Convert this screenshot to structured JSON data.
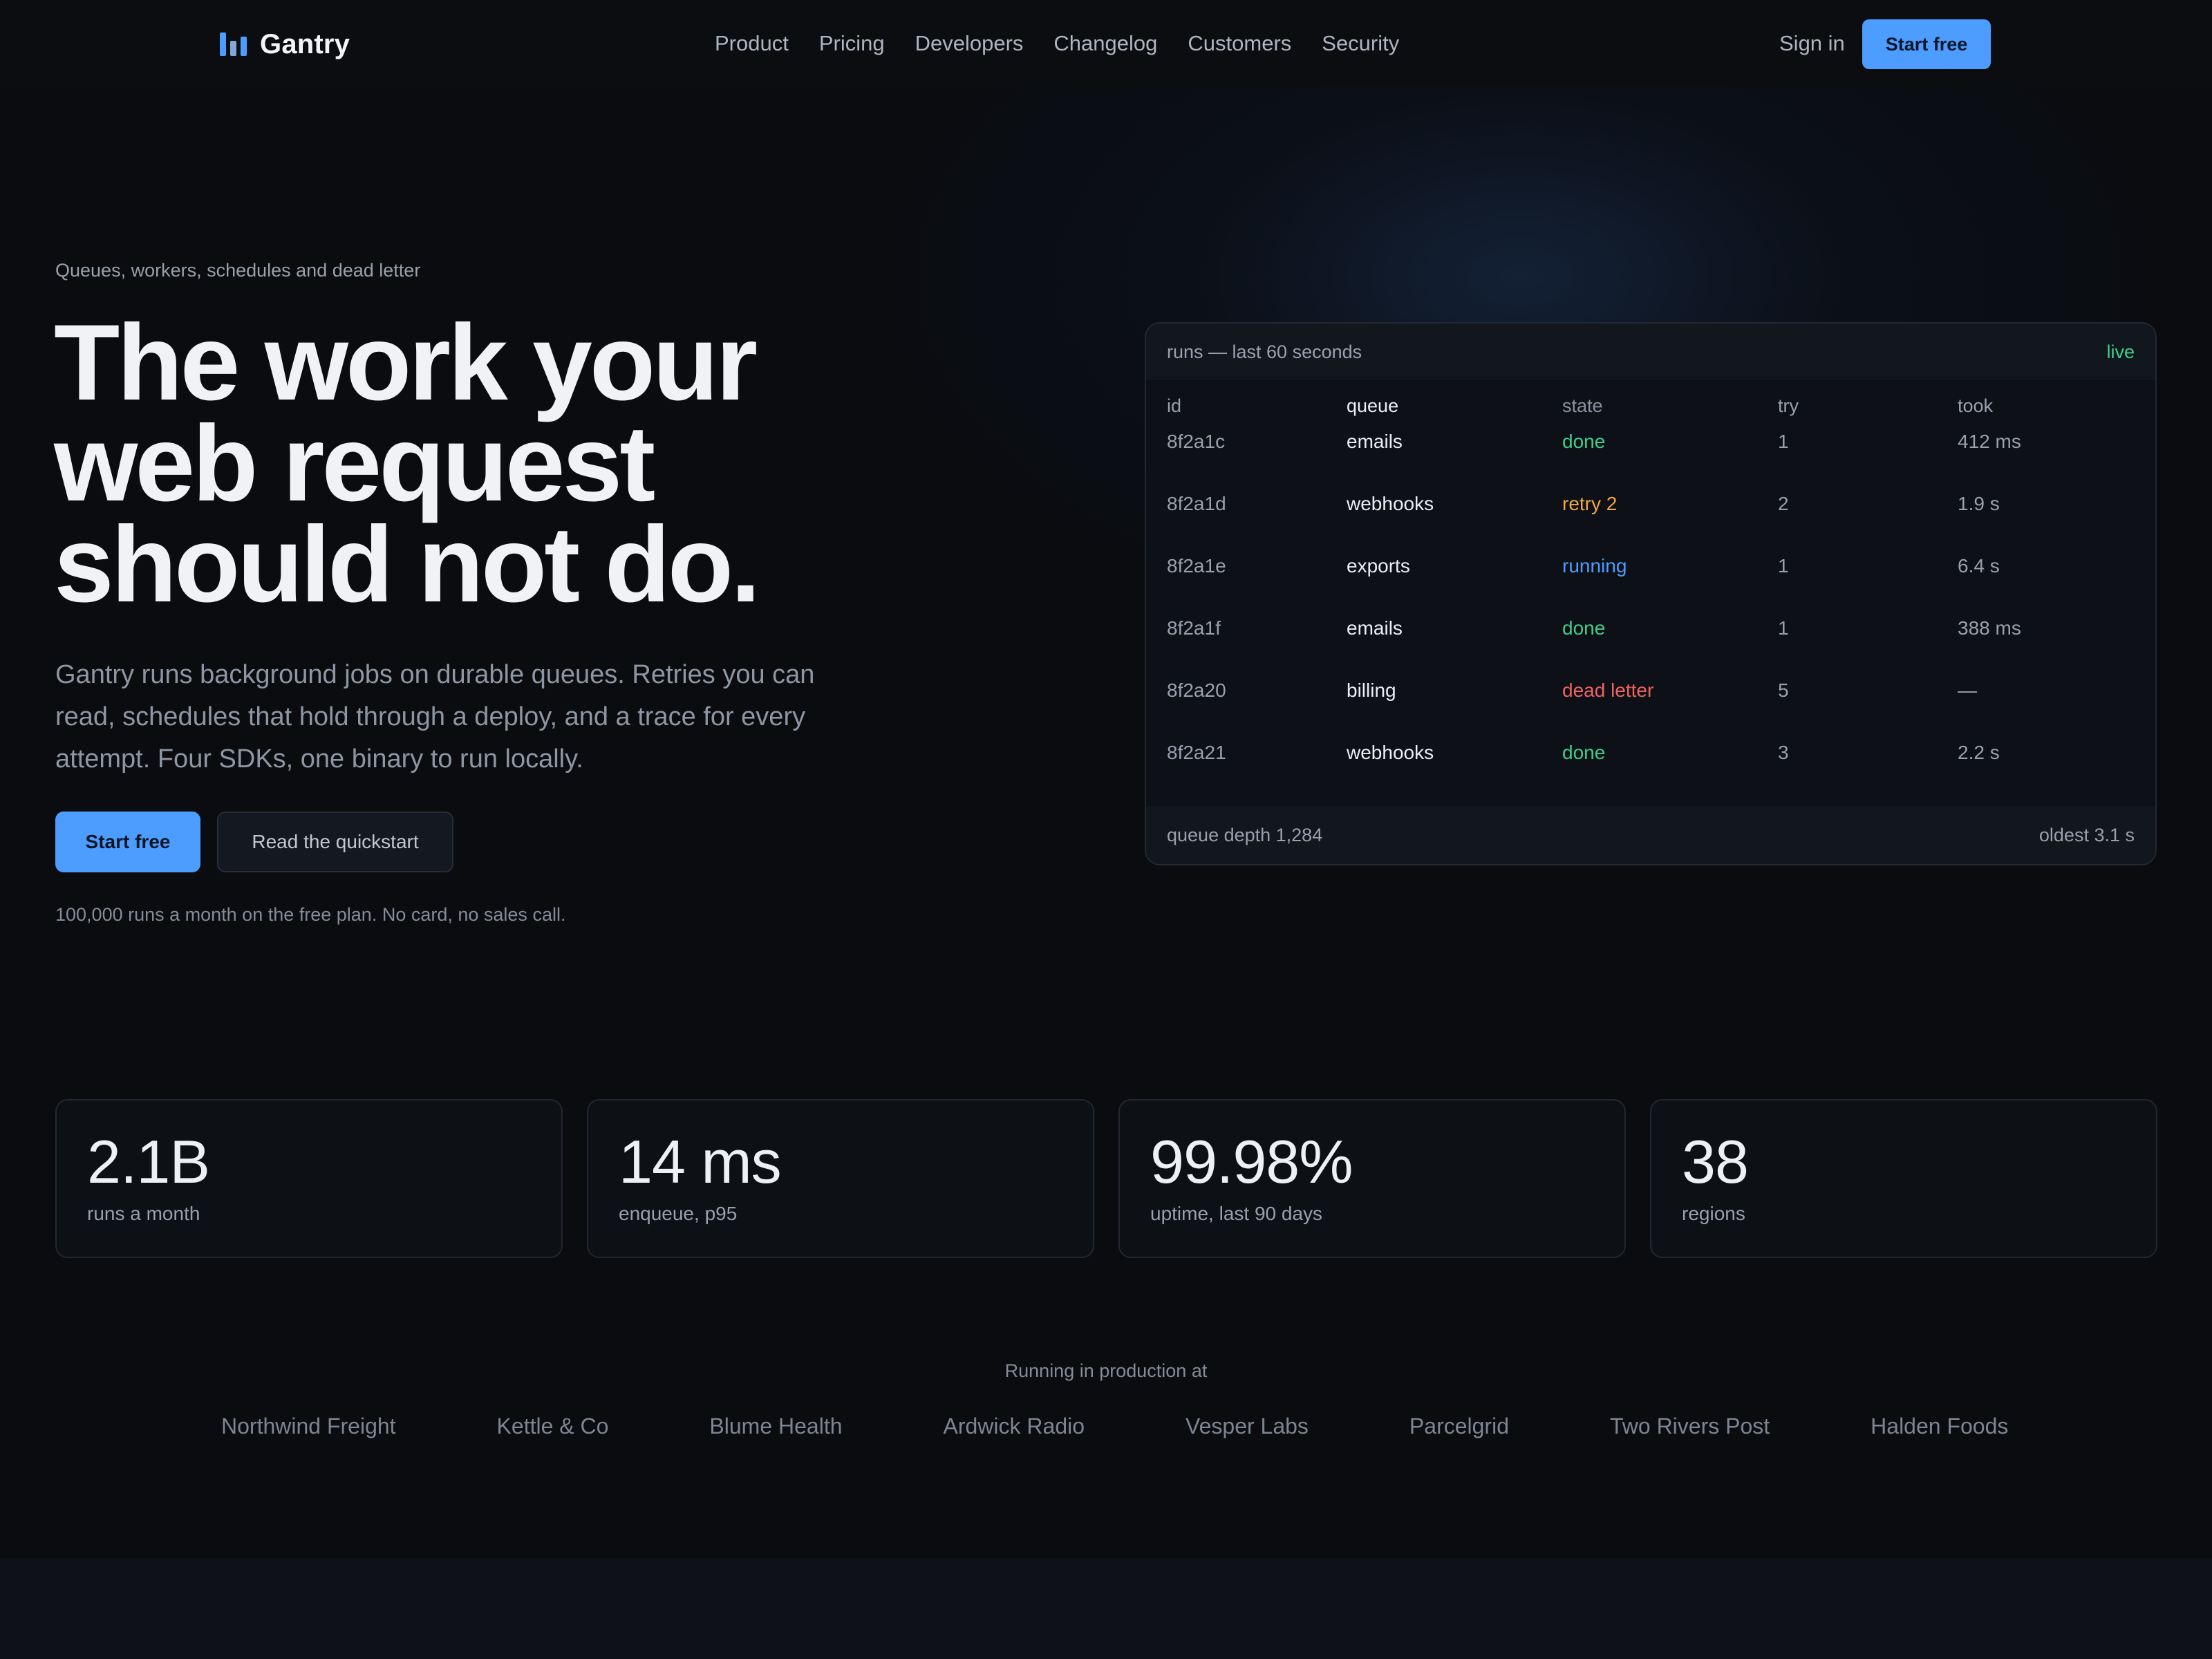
{
  "nav": {
    "brand": "Gantry",
    "links": [
      "Product",
      "Pricing",
      "Developers",
      "Changelog",
      "Customers",
      "Security"
    ],
    "sign_in": "Sign in",
    "cta": "Start free"
  },
  "hero": {
    "eyebrow": "Queues, workers, schedules and dead letter",
    "headline": [
      "The work your",
      "web request",
      "should not do."
    ],
    "lede": "Gantry runs background jobs on durable queues. Retries you can read, schedules that hold through a deploy, and a trace for every attempt. Four SDKs, one binary to run locally.",
    "primary_cta": "Start free",
    "secondary_cta": "Read the quickstart",
    "fineprint": "100,000 runs a month on the free plan. No card, no sales call."
  },
  "runs_panel": {
    "title": "runs — last 60 seconds",
    "status": "live",
    "columns": [
      "id",
      "queue",
      "state",
      "try",
      "took"
    ],
    "rows": [
      {
        "id": "8f2a1c",
        "queue": "emails",
        "state": "done",
        "try": "1",
        "took": "412 ms"
      },
      {
        "id": "8f2a1d",
        "queue": "webhooks",
        "state": "retry 2",
        "try": "2",
        "took": "1.9 s"
      },
      {
        "id": "8f2a1e",
        "queue": "exports",
        "state": "running",
        "try": "1",
        "took": "6.4 s"
      },
      {
        "id": "8f2a1f",
        "queue": "emails",
        "state": "done",
        "try": "1",
        "took": "388 ms"
      },
      {
        "id": "8f2a20",
        "queue": "billing",
        "state": "dead letter",
        "try": "5",
        "took": "—"
      },
      {
        "id": "8f2a21",
        "queue": "webhooks",
        "state": "done",
        "try": "3",
        "took": "2.2 s"
      }
    ],
    "footer_left": "queue depth 1,284",
    "footer_right": "oldest 3.1 s",
    "state_colors": {
      "done": "#3ecf8e",
      "retry": "#f0a842",
      "running": "#4c9dff",
      "dead_letter": "#f06262"
    }
  },
  "stats": [
    {
      "value": "2.1B",
      "label": "runs a month"
    },
    {
      "value": "14 ms",
      "label": "enqueue, p95"
    },
    {
      "value": "99.98%",
      "label": "uptime, last 90 days"
    },
    {
      "value": "38",
      "label": "regions"
    }
  ],
  "customers": {
    "title": "Running in production at",
    "logos": [
      "Northwind Freight",
      "Kettle & Co",
      "Blume Health",
      "Ardwick Radio",
      "Vesper Labs",
      "Parcelgrid",
      "Two Rivers Post",
      "Halden Foods"
    ]
  },
  "colors": {
    "accent": "#4c9dff",
    "background": "#0a0c10"
  }
}
